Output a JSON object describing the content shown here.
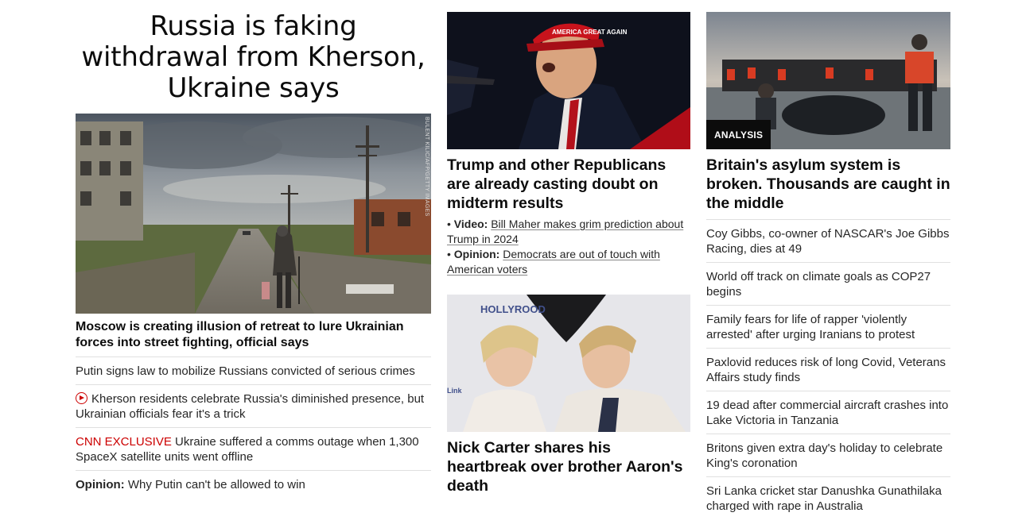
{
  "left": {
    "title": "Russia is faking withdrawal from Kherson, Ukraine says",
    "image_credit": "BULENT KILIC/AFP/GETTY IMAGES",
    "headline": "Moscow is creating illusion of retreat to lure Ukrainian forces into street fighting, official says",
    "items": [
      {
        "text": "Putin signs law to mobilize Russians convicted of serious crimes"
      },
      {
        "text": "Kherson residents celebrate Russia's diminished presence, but Ukrainian officials fear it's a trick",
        "icon": "play-video-icon"
      },
      {
        "prefix": "CNN EXCLUSIVE",
        "text": " Ukraine suffered a comms outage when 1,300 SpaceX satellite units went offline"
      },
      {
        "prefix": "Opinion:",
        "text": " Why Putin can't be allowed to win"
      }
    ]
  },
  "middle": {
    "story1": {
      "headline": "Trump and other Republicans are already casting doubt on midterm results",
      "cap_text": "AMERICA GREAT AGAIN",
      "sub": [
        {
          "bullet": "•",
          "label": "Video:",
          "text": "Bill Maher makes grim prediction about Trump in 2024"
        },
        {
          "bullet": "•",
          "label": "Opinion:",
          "text": "Democrats are out of touch with American voters"
        }
      ]
    },
    "story2": {
      "headline": "Nick Carter shares his heartbreak over brother Aaron's death",
      "backdrop_text": "HOLLYROOD",
      "backdrop_small": "Link"
    }
  },
  "right": {
    "badge": "ANALYSIS",
    "headline": "Britain's asylum system is broken. Thousands are caught in the middle",
    "items": [
      "Coy Gibbs, co-owner of NASCAR's Joe Gibbs Racing, dies at 49",
      "World off track on climate goals as COP27 begins",
      "Family fears for life of rapper 'violently arrested' after urging Iranians to protest",
      "Paxlovid reduces risk of long Covid, Veterans Affairs study finds",
      "19 dead after commercial aircraft crashes into Lake Victoria in Tanzania",
      "Britons given extra day's holiday to celebrate King's coronation",
      "Sri Lanka cricket star Danushka Gunathilaka charged with rape in Australia"
    ]
  },
  "colors": {
    "accent_red": "#cc0000",
    "text": "#0c0c0c",
    "divider": "#e0e0e0"
  }
}
